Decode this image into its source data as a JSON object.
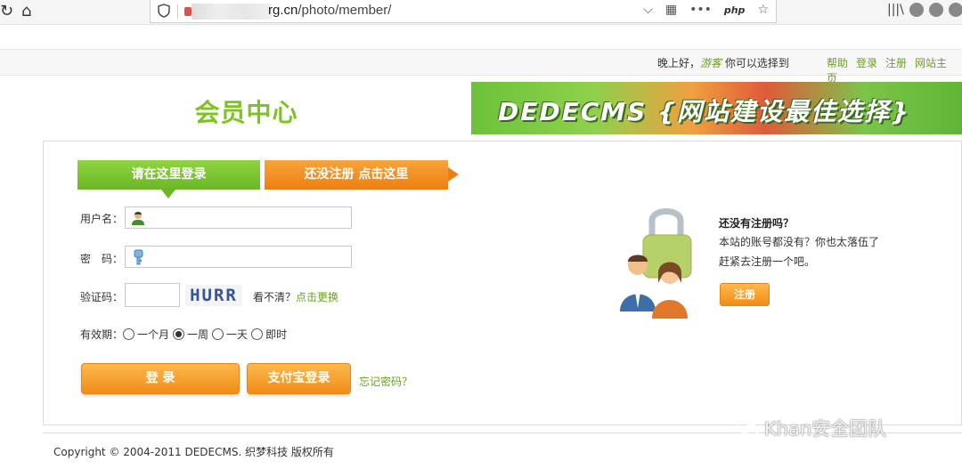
{
  "browser": {
    "url_host": "rg.cn",
    "url_path": "/photo/member/",
    "php_label": "php"
  },
  "topbar": {
    "greeting": "晚上好，",
    "guest": "游客",
    "choose": " 你可以选择到",
    "links": [
      "帮助",
      "登录",
      "注册",
      "网站主页"
    ]
  },
  "header": {
    "logo_text": "会员中心",
    "banner_text": "DEDECMS {网站建设最佳选择}"
  },
  "tabs": {
    "login": "请在这里登录",
    "register": "还没注册 点击这里"
  },
  "form": {
    "username_label": "用户名：",
    "password_label": "密　码：",
    "captcha_label": "验证码：",
    "captcha_text": "HURR",
    "unclear": "看不清？",
    "refresh": "点击更换",
    "validity_label": "有效期：",
    "validity_options": [
      "一个月",
      "一周",
      "一天",
      "即时"
    ],
    "validity_selected": "一周",
    "login_button": "登 录",
    "alipay_button": "支付宝登录",
    "forgot": "忘记密码？"
  },
  "register_panel": {
    "title": "还没有注册吗？",
    "desc1": "本站的账号都没有？你也太落伍了",
    "desc2": "赶紧去注册一个吧。",
    "button": "注册"
  },
  "footer": {
    "copyright": "Copyright © 2004-2011 DEDECMS. 织梦科技 版权所有"
  },
  "watermark": "Khan安全团队",
  "colors": {
    "green": "#6bb725",
    "orange": "#f28c17",
    "link_green": "#6aa020"
  }
}
